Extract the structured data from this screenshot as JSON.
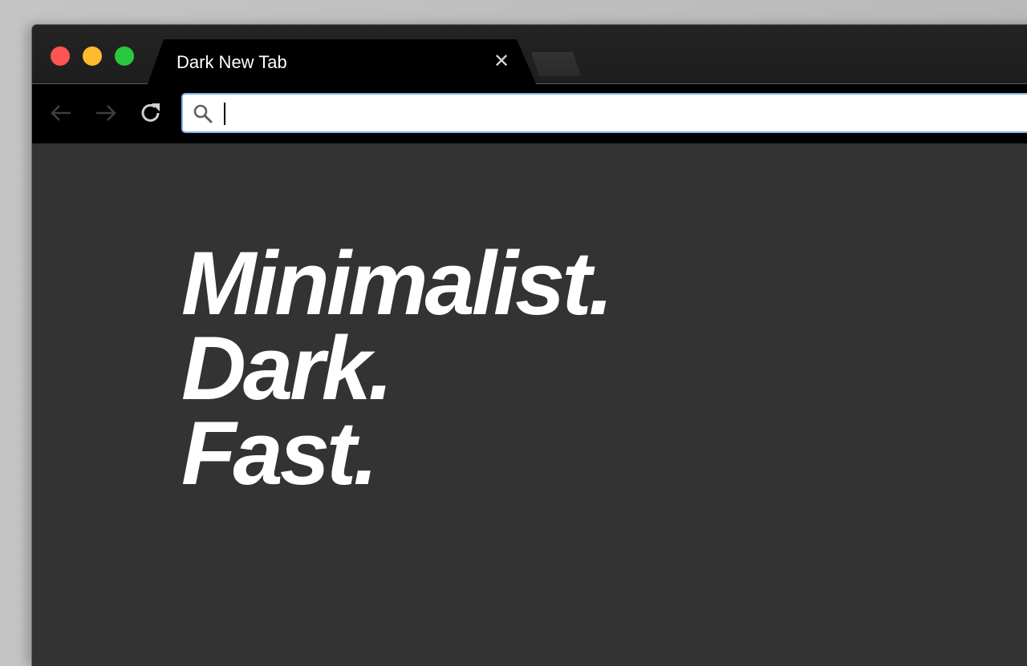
{
  "browser": {
    "active_tab": {
      "title": "Dark New Tab",
      "close_label": "✕"
    },
    "new_tab_label": "",
    "traffic_lights": {
      "close_color": "#fd5652",
      "minimize_color": "#fdba2f",
      "maximize_color": "#2ac83f"
    },
    "nav": {
      "back_icon": "arrow-left-icon",
      "forward_icon": "arrow-right-icon",
      "reload_icon": "reload-icon"
    },
    "omnibox": {
      "value": "",
      "placeholder": "",
      "icon": "search-icon",
      "focus_color": "#7fb2ea"
    }
  },
  "page": {
    "background": "#333333",
    "headline": [
      "Minimalist.",
      "Dark.",
      "Fast."
    ]
  }
}
